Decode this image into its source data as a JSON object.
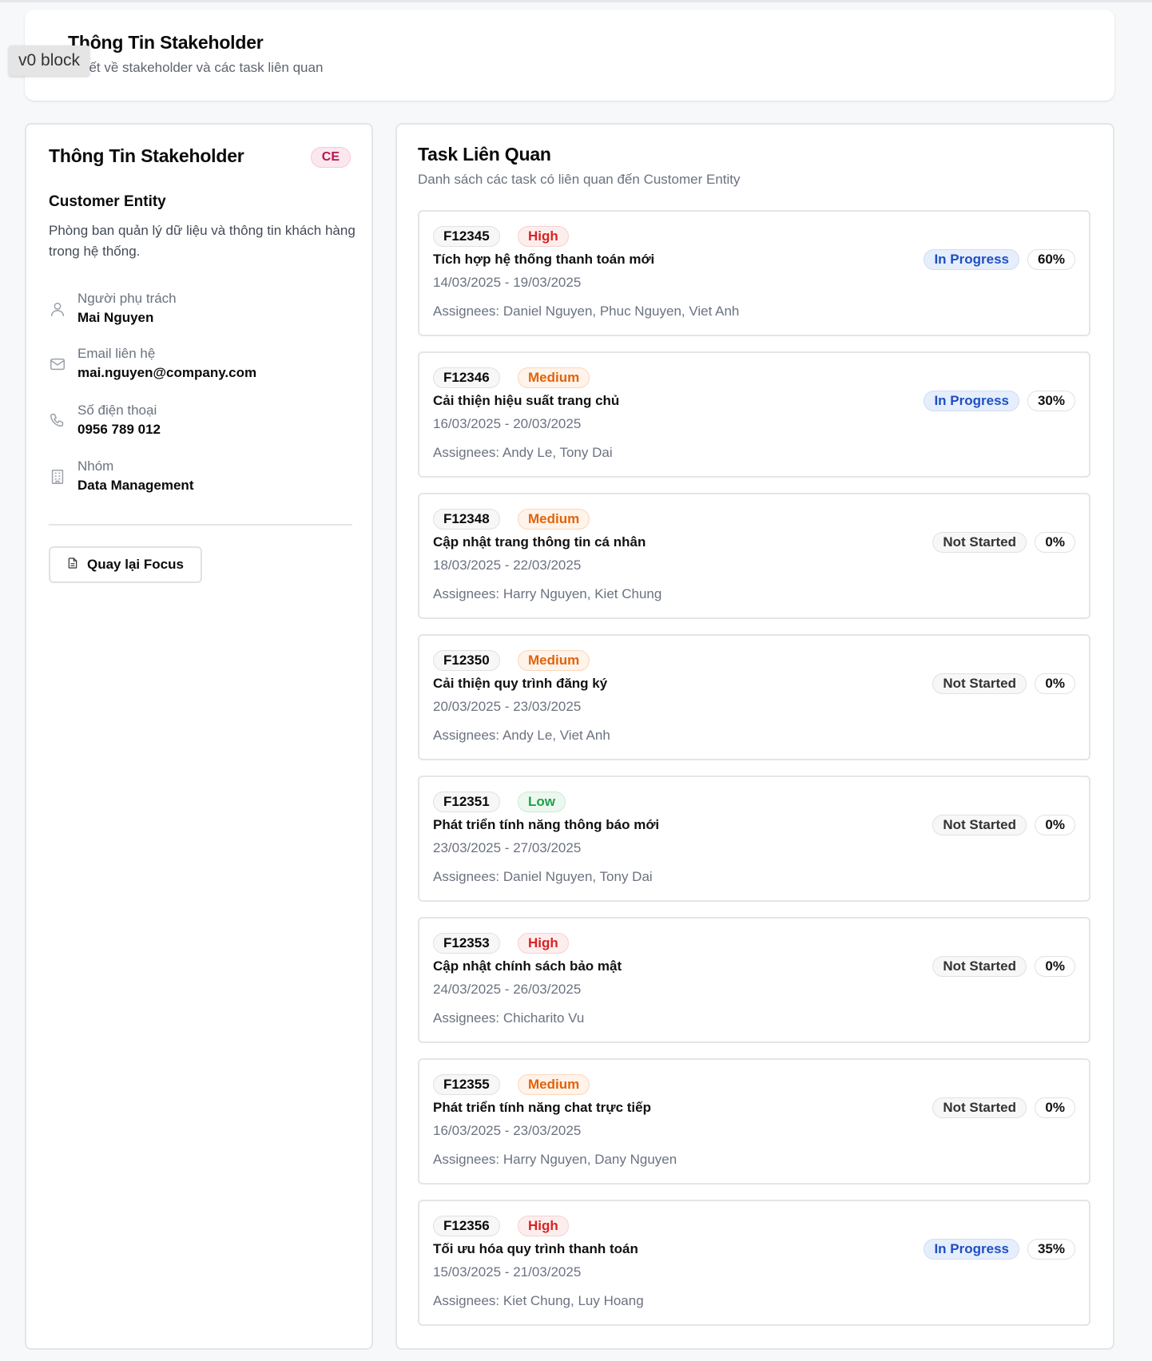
{
  "header": {
    "title": "Thông Tin Stakeholder",
    "subtitle": "hi tiết về stakeholder và các task liên quan",
    "v0_badge": "v0 block"
  },
  "stakeholder": {
    "title": "Thông Tin Stakeholder",
    "badge": "CE",
    "name": "Customer Entity",
    "description": "Phòng ban quản lý dữ liệu và thông tin khách hàng trong hệ thống.",
    "fields": [
      {
        "label": "Người phụ trách",
        "value": "Mai Nguyen",
        "icon": "user-icon"
      },
      {
        "label": "Email liên hệ",
        "value": "mai.nguyen@company.com",
        "icon": "mail-icon"
      },
      {
        "label": "Số điện thoại",
        "value": "0956 789 012",
        "icon": "phone-icon"
      },
      {
        "label": "Nhóm",
        "value": "Data Management",
        "icon": "building-icon"
      }
    ],
    "back_button": "Quay lại Focus"
  },
  "tasks_panel": {
    "title": "Task Liên Quan",
    "subtitle": "Danh sách các task có liên quan đến Customer Entity"
  },
  "tasks": [
    {
      "id": "F12345",
      "priority": "High",
      "name": "Tích hợp hệ thống thanh toán mới",
      "dates": "14/03/2025 - 19/03/2025",
      "assignees": "Assignees: Daniel Nguyen, Phuc Nguyen, Viet Anh",
      "status": "In Progress",
      "progress": "60%"
    },
    {
      "id": "F12346",
      "priority": "Medium",
      "name": "Cải thiện hiệu suất trang chủ",
      "dates": "16/03/2025 - 20/03/2025",
      "assignees": "Assignees: Andy Le, Tony Dai",
      "status": "In Progress",
      "progress": "30%"
    },
    {
      "id": "F12348",
      "priority": "Medium",
      "name": "Cập nhật trang thông tin cá nhân",
      "dates": "18/03/2025 - 22/03/2025",
      "assignees": "Assignees: Harry Nguyen, Kiet Chung",
      "status": "Not Started",
      "progress": "0%"
    },
    {
      "id": "F12350",
      "priority": "Medium",
      "name": "Cải thiện quy trình đăng ký",
      "dates": "20/03/2025 - 23/03/2025",
      "assignees": "Assignees: Andy Le, Viet Anh",
      "status": "Not Started",
      "progress": "0%"
    },
    {
      "id": "F12351",
      "priority": "Low",
      "name": "Phát triển tính năng thông báo mới",
      "dates": "23/03/2025 - 27/03/2025",
      "assignees": "Assignees: Daniel Nguyen, Tony Dai",
      "status": "Not Started",
      "progress": "0%"
    },
    {
      "id": "F12353",
      "priority": "High",
      "name": "Cập nhật chính sách bảo mật",
      "dates": "24/03/2025 - 26/03/2025",
      "assignees": "Assignees: Chicharito Vu",
      "status": "Not Started",
      "progress": "0%"
    },
    {
      "id": "F12355",
      "priority": "Medium",
      "name": "Phát triển tính năng chat trực tiếp",
      "dates": "16/03/2025 - 23/03/2025",
      "assignees": "Assignees: Harry Nguyen, Dany Nguyen",
      "status": "Not Started",
      "progress": "0%"
    },
    {
      "id": "F12356",
      "priority": "High",
      "name": "Tối ưu hóa quy trình thanh toán",
      "dates": "15/03/2025 - 21/03/2025",
      "assignees": "Assignees: Kiet Chung, Luy Hoang",
      "status": "In Progress",
      "progress": "35%"
    }
  ],
  "colors": {
    "high": "#d92323",
    "medium": "#e2620a",
    "low": "#22a04b",
    "in_progress": "#1d4fc4",
    "ce_badge": "#b3164f"
  }
}
